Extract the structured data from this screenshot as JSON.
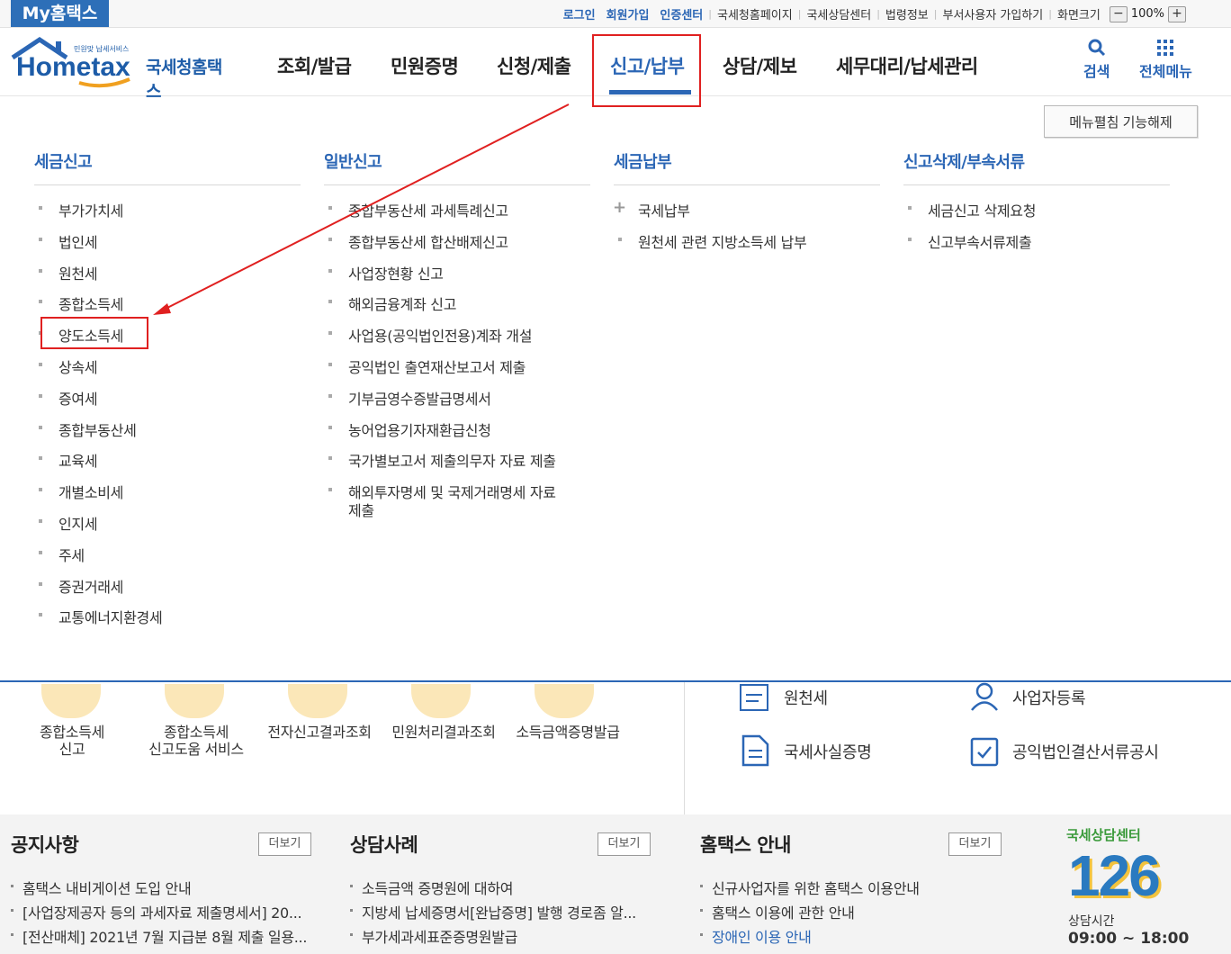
{
  "topbar": {
    "brand": "My홈택스",
    "links": [
      "로그인",
      "회원가입",
      "인증센터",
      "국세청홈페이지",
      "국세상담센터",
      "법령정보",
      "부서사용자 가입하기",
      "화면크기"
    ],
    "zoom_minus": "−",
    "zoom_value": "100%",
    "zoom_plus": "+"
  },
  "logo": {
    "wordmark": "Hometax",
    "service_name": "국세청홈택스",
    "tagline": "민원맞 납세서비스"
  },
  "gnb": {
    "items": [
      "조회/발급",
      "민원증명",
      "신청/제출",
      "신고/납부",
      "상담/제보",
      "세무대리/납세관리"
    ],
    "active_index": 3,
    "search_label": "검색",
    "all_menu_label": "전체메뉴"
  },
  "dropdown": {
    "unfold_button": "메뉴펼침 기능해제",
    "columns": [
      {
        "title": "세금신고",
        "items": [
          "부가가치세",
          "법인세",
          "원천세",
          "종합소득세",
          "양도소득세",
          "상속세",
          "증여세",
          "종합부동산세",
          "교육세",
          "개별소비세",
          "인지세",
          "주세",
          "증권거래세",
          "교통에너지환경세"
        ]
      },
      {
        "title": "일반신고",
        "items": [
          "종합부동산세 과세특례신고",
          "종합부동산세 합산배제신고",
          "사업장현황 신고",
          "해외금융계좌 신고",
          "사업용(공익법인전용)계좌 개설",
          "공익법인 출연재산보고서 제출",
          "기부금영수증발급명세서",
          "농어업용기자재환급신청",
          "국가별보고서 제출의무자 자료 제출",
          "해외투자명세 및 국제거래명세 자료",
          "제출"
        ]
      },
      {
        "title": "세금납부",
        "items": [
          "국세납부",
          "원천세 관련 지방소득세 납부"
        ]
      },
      {
        "title": "신고삭제/부속서류",
        "items": [
          "세금신고 삭제요청",
          "신고부속서류제출"
        ]
      }
    ],
    "highlighted_item": "양도소득세"
  },
  "services": {
    "labels": [
      {
        "l1": "종합소득세",
        "l2": "신고"
      },
      {
        "l1": "종합소득세",
        "l2": "신고도움 서비스"
      },
      {
        "l1": "전자신고결과조회",
        "l2": ""
      },
      {
        "l1": "민원처리결과조회",
        "l2": ""
      },
      {
        "l1": "소득금액증명발급",
        "l2": ""
      }
    ],
    "quick": [
      "원천세",
      "사업자등록",
      "국세사실증명",
      "공익법인결산서류공시"
    ]
  },
  "bottom": {
    "more_label": "더보기",
    "notices": {
      "title": "공지사항",
      "items": [
        "홈택스 내비게이션 도입 안내",
        "[사업장제공자 등의 과세자료 제출명세서] 20...",
        "[전산매체] 2021년 7월 지급분 8월 제출 일용..."
      ]
    },
    "cases": {
      "title": "상담사례",
      "items": [
        "소득금액 증명원에 대하여",
        "지방세 납세증명서[완납증명] 발행 경로좀 알...",
        "부가세과세표준증명원발급"
      ]
    },
    "guide": {
      "title": "홈택스 안내",
      "items": [
        "신규사업자를 위한 홈택스 이용안내",
        "홈택스 이용에 관한 안내",
        "장애인 이용 안내"
      ]
    },
    "call_center": {
      "caption": "국세상담센터",
      "number": "126",
      "hours_label": "상담시간",
      "hours": "09:00 ~ 18:00"
    }
  },
  "colors": {
    "primary": "#2b66b5",
    "highlight": "#e02020"
  }
}
